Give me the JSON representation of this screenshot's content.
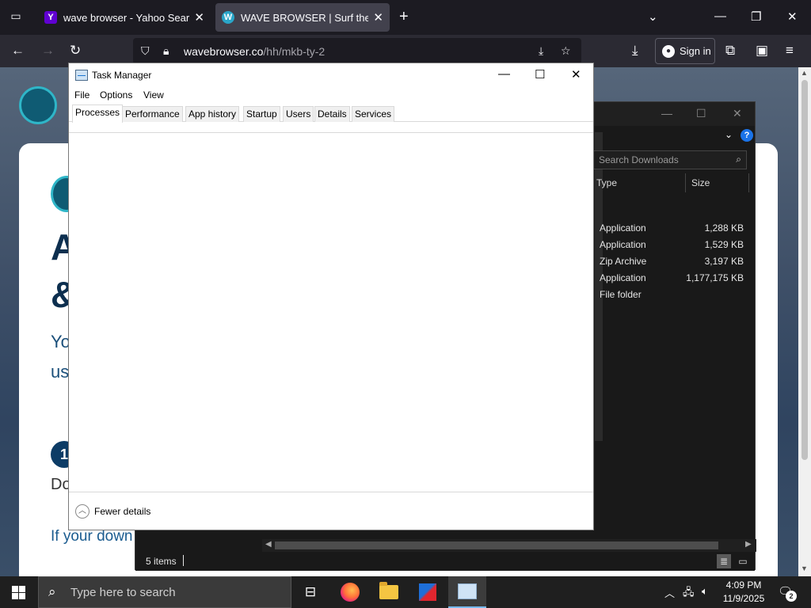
{
  "browser": {
    "tabs": [
      {
        "title": "wave browser - Yahoo Search R",
        "favicon": "Y",
        "active": false
      },
      {
        "title": "WAVE BROWSER | Surf the web",
        "favicon": "W",
        "active": true
      }
    ],
    "url_host": "wavebrowser.co",
    "url_path": "/hh/mkb-ty-2",
    "sign_in_label": "Sign in",
    "icons": {
      "new_tab": "+",
      "back": "←",
      "forward": "→",
      "reload": "↻",
      "menu": "≡"
    }
  },
  "webpage": {
    "h1_line1": "A",
    "h1_line2": "&",
    "sub_line1": "Yo",
    "sub_line2": "us",
    "step_number": "1",
    "step_text": "Do",
    "footer_text": "If your down"
  },
  "explorer": {
    "search_placeholder": "Search Downloads",
    "columns": {
      "type": "Type",
      "size": "Size"
    },
    "rows": [
      {
        "type": "Application",
        "size": "1,288 KB"
      },
      {
        "type": "Application",
        "size": "1,529 KB"
      },
      {
        "type": "Zip Archive",
        "size": "3,197 KB"
      },
      {
        "type": "Application",
        "size": "1,177,175 KB"
      },
      {
        "type": "File folder",
        "size": ""
      }
    ],
    "status": "5 items",
    "help_label": "?"
  },
  "task_manager": {
    "title": "Task Manager",
    "menu": [
      "File",
      "Options",
      "View"
    ],
    "tabs": [
      "Processes",
      "Performance",
      "App history",
      "Startup",
      "Users",
      "Details",
      "Services"
    ],
    "active_tab": "Processes",
    "fewer_details": "Fewer details"
  },
  "taskbar": {
    "search_placeholder": "Type here to search",
    "time": "4:09 PM",
    "date": "11/9/2025",
    "notification_count": "2"
  }
}
